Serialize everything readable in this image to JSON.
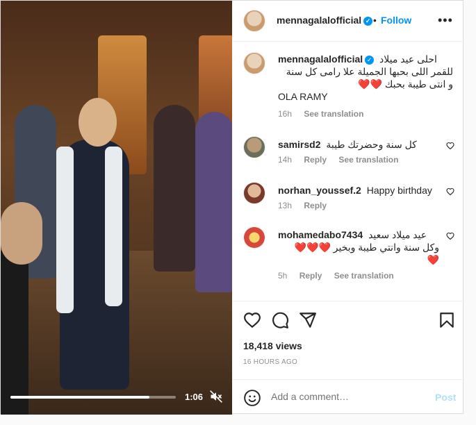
{
  "video": {
    "time": "1:06",
    "progress": 0.84
  },
  "header": {
    "username": "mennagalalofficial",
    "separator": "•",
    "follow_label": "Follow",
    "more_label": "•••"
  },
  "caption": {
    "username": "mennagalalofficial",
    "text_line1": "احلى عيد ميلاد",
    "text_line2": "للقمر اللى بحبها الجميلة علا رامى كل سنة",
    "text_line3": "و انتى طيبة بحبك ❤️❤️",
    "text_line4": "OLA RAMY",
    "time": "16h",
    "see_translation": "See translation"
  },
  "comments": [
    {
      "username": "samirsd2",
      "text": "كل سنة وحضرتك طيبة",
      "time": "14h",
      "reply": "Reply",
      "see_translation": "See translation"
    },
    {
      "username": "norhan_youssef.2",
      "text": "Happy birthday",
      "time": "13h",
      "reply": "Reply"
    },
    {
      "username": "mohamedabo7434",
      "text_line1": "عيد ميلاد سعيد",
      "text_line2": "وكل سنة وانتي طيبة وبخير ❤️❤️❤️",
      "text_line3": "❤️",
      "time": "5h",
      "reply": "Reply",
      "see_translation": "See translation"
    }
  ],
  "stats": {
    "views": "18,418 views",
    "posted": "16 HOURS AGO"
  },
  "add_comment": {
    "placeholder": "Add a comment…",
    "post_label": "Post"
  },
  "colors": {
    "accent": "#0095f6",
    "post_disabled": "#b2dffc",
    "muted_text": "#8e8e8e"
  },
  "icons": [
    "verified-icon",
    "more-options-icon",
    "heart-icon",
    "comment-icon",
    "share-icon",
    "bookmark-icon",
    "emoji-icon",
    "mute-icon"
  ]
}
